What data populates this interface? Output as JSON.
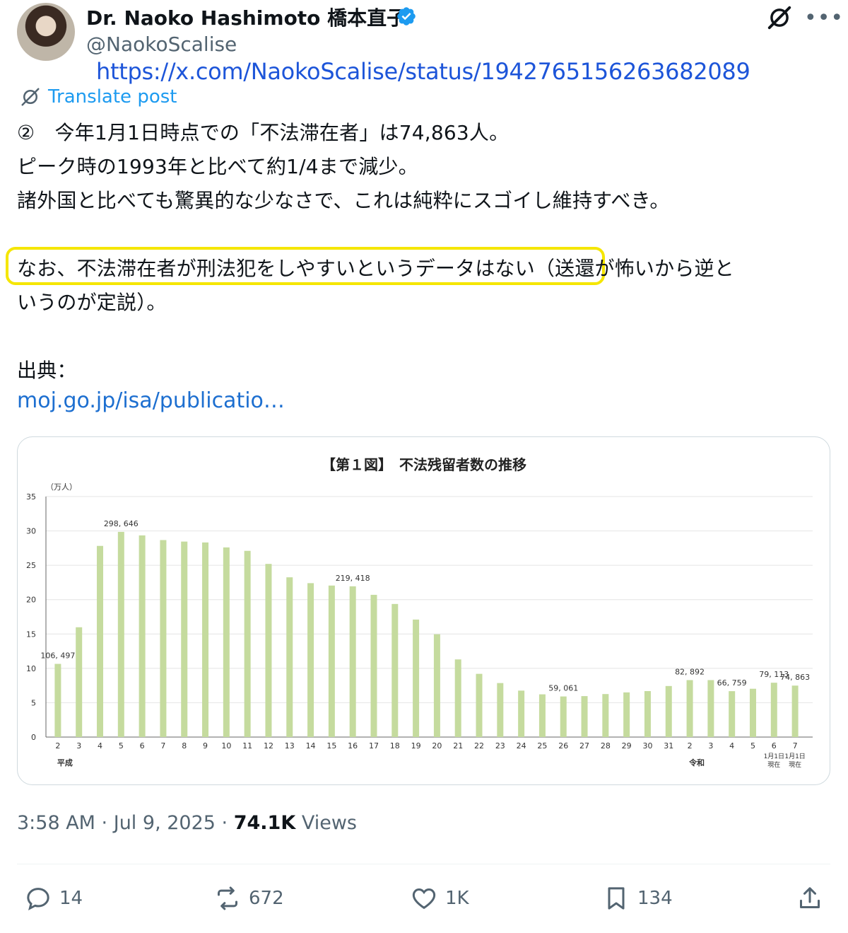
{
  "author": {
    "name": "Dr. Naoko Hashimoto 橋本直子",
    "handle": "@NaokoScalise",
    "url": "https://x.com/NaokoScalise/status/1942765156263682089"
  },
  "translate_label": "Translate post",
  "post": {
    "lines": [
      "②　今年1月1日時点での「不法滞在者」は74,863人。",
      "ピーク時の1993年と比べて約1/4まで減少。",
      "諸外国と比べても驚異的な少なさで、これは純粋にスゴイし維持すべき。",
      "なお、不法滞在者が刑法犯をしやすいというデータはない（送還が怖いから逆と",
      "いうのが定説）。",
      "出典："
    ],
    "link": "moj.go.jp/isa/publicatio…"
  },
  "chart_data": {
    "type": "bar",
    "title": "【第１図】　不法残留者数の推移",
    "yunit": "（万人）",
    "ylim": [
      0,
      35
    ],
    "yticks": [
      0,
      5,
      10,
      15,
      20,
      25,
      30,
      35
    ],
    "categories": [
      "2",
      "3",
      "4",
      "5",
      "6",
      "7",
      "8",
      "9",
      "10",
      "11",
      "12",
      "13",
      "14",
      "15",
      "16",
      "17",
      "18",
      "19",
      "20",
      "21",
      "22",
      "23",
      "24",
      "25",
      "26",
      "27",
      "28",
      "29",
      "30",
      "31",
      "2",
      "3",
      "4",
      "5",
      "6",
      "7"
    ],
    "values": [
      10.65,
      15.98,
      27.82,
      29.86,
      29.35,
      28.67,
      28.45,
      28.32,
      27.6,
      27.1,
      25.2,
      23.25,
      22.4,
      22.05,
      21.94,
      20.7,
      19.37,
      17.1,
      14.96,
      11.3,
      9.2,
      7.86,
      6.76,
      6.22,
      5.91,
      5.96,
      6.26,
      6.5,
      6.69,
      7.43,
      8.29,
      8.29,
      6.68,
      7.03,
      7.91,
      7.49
    ],
    "data_labels": [
      {
        "index": 0,
        "text": "106, 497"
      },
      {
        "index": 3,
        "text": "298, 646"
      },
      {
        "index": 14,
        "text": "219, 418"
      },
      {
        "index": 24,
        "text": "59, 061"
      },
      {
        "index": 30,
        "text": "82, 892"
      },
      {
        "index": 32,
        "text": "66, 759"
      },
      {
        "index": 34,
        "text": "79, 113"
      },
      {
        "index": 35,
        "text": "74, 863"
      }
    ],
    "era_labels": [
      {
        "index": 0,
        "text": "平成"
      },
      {
        "index": 30,
        "text": "令和"
      }
    ],
    "sub_labels": [
      {
        "index": 34,
        "text": "1月1日\n現在"
      },
      {
        "index": 35,
        "text": "1月1日\n現在"
      }
    ],
    "bar_color": "#c5db9e",
    "grid": true
  },
  "meta": {
    "time": "3:58 AM · Jul 9, 2025 · ",
    "views_count": "74.1K",
    "views_label": " Views"
  },
  "actions": {
    "replies": "14",
    "reposts": "672",
    "likes": "1K",
    "bookmarks": "134"
  },
  "colors": {
    "accent": "#1d9bf0",
    "highlight": "#f5e600"
  }
}
